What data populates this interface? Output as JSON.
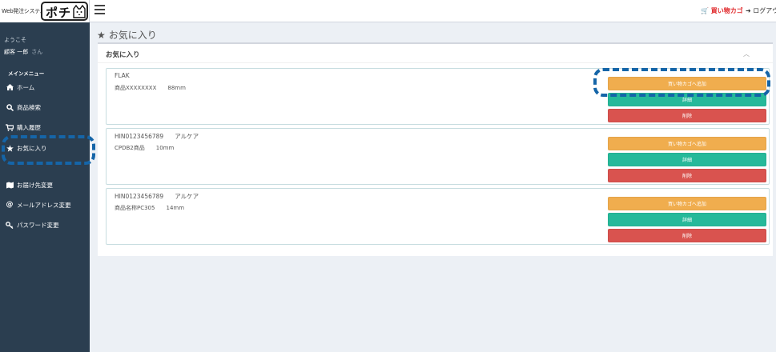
{
  "header": {
    "logo_small_text": "Web発注システム",
    "logo_text": "ポチ",
    "cart_label": "買い物カゴ",
    "logout_label": "ログアウ"
  },
  "sidebar": {
    "welcome": "ようこそ",
    "user_name": "顧客 一郎",
    "user_suffix": "さん",
    "menu_header": "メインメニュー",
    "items": [
      {
        "label": "ホーム",
        "icon": "home-icon"
      },
      {
        "label": "商品検索",
        "icon": "search-icon"
      },
      {
        "label": "購入履歴",
        "icon": "cart-icon"
      },
      {
        "label": "お気に入り",
        "icon": "star-icon"
      },
      {
        "label": "お届け先変更",
        "icon": "map-icon"
      },
      {
        "label": "メールアドレス変更",
        "icon": "at-icon"
      },
      {
        "label": "パスワード変更",
        "icon": "key-icon"
      }
    ]
  },
  "main": {
    "page_title": "お気に入り",
    "box_title": "お気に入り",
    "buttons": {
      "add_cart": "買い物カゴへ追加",
      "detail": "詳細",
      "delete": "削除"
    },
    "favorites": [
      {
        "code": "FLAK",
        "maker": "",
        "name": "商品XXXXXXXX",
        "size": "88mm"
      },
      {
        "code": "HIN0123456789",
        "maker": "アルケア",
        "name": "CPDB2商品",
        "size": "10mm"
      },
      {
        "code": "HIN0123456789",
        "maker": "アルケア",
        "name": "商品名称PC305",
        "size": "14mm"
      }
    ]
  },
  "colors": {
    "sidebar_bg": "#2b3e50",
    "cart_button": "#f0ad4e",
    "detail_button": "#26b99a",
    "delete_button": "#d9534f",
    "highlight": "#1565a8",
    "cart_link": "#e0292c"
  }
}
